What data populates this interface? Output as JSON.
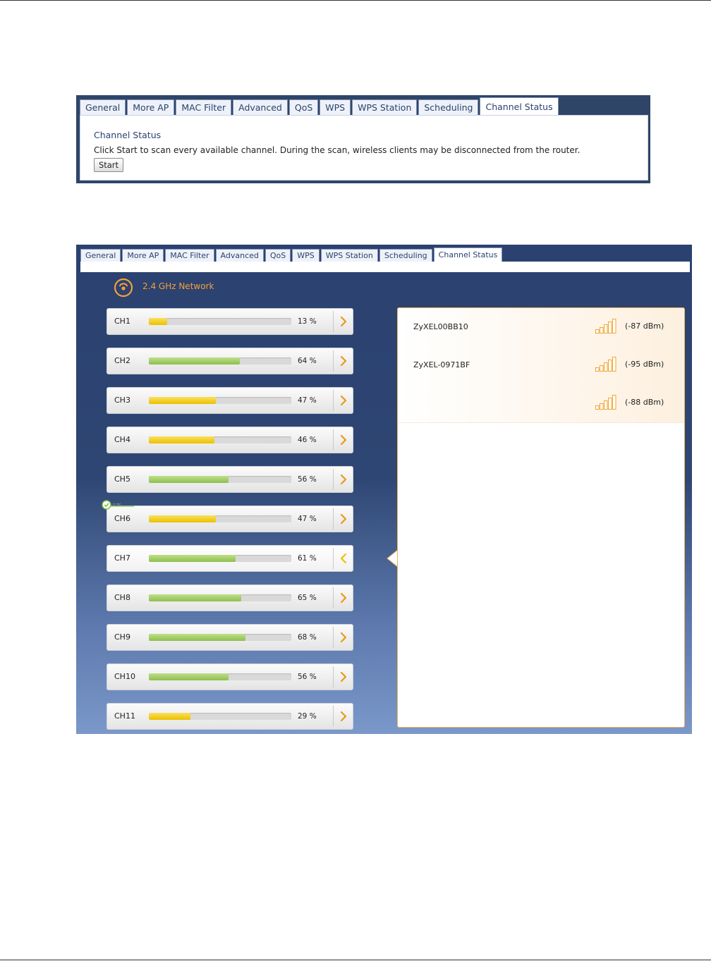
{
  "tabs": [
    "General",
    "More AP",
    "MAC Filter",
    "Advanced",
    "QoS",
    "WPS",
    "WPS Station",
    "Scheduling",
    "Channel Status"
  ],
  "active_tab": "Channel Status",
  "channel_status_panel": {
    "title": "Channel Status",
    "description": "Click Start to scan every available channel. During the scan, wireless clients may be disconnected from the router.",
    "start_button": "Start"
  },
  "scan_results": {
    "network_label": "2.4 GHz Network",
    "in_use_label": "In Use",
    "channels": [
      {
        "name": "CH1",
        "percent": 13,
        "percent_label": "13 %",
        "bar_color": "yellow"
      },
      {
        "name": "CH2",
        "percent": 64,
        "percent_label": "64 %",
        "bar_color": "green"
      },
      {
        "name": "CH3",
        "percent": 47,
        "percent_label": "47 %",
        "bar_color": "yellow"
      },
      {
        "name": "CH4",
        "percent": 46,
        "percent_label": "46 %",
        "bar_color": "yellow"
      },
      {
        "name": "CH5",
        "percent": 56,
        "percent_label": "56 %",
        "bar_color": "green"
      },
      {
        "name": "CH6",
        "percent": 47,
        "percent_label": "47 %",
        "bar_color": "yellow",
        "in_use": true
      },
      {
        "name": "CH7",
        "percent": 61,
        "percent_label": "61 %",
        "bar_color": "green",
        "selected": true
      },
      {
        "name": "CH8",
        "percent": 65,
        "percent_label": "65 %",
        "bar_color": "green"
      },
      {
        "name": "CH9",
        "percent": 68,
        "percent_label": "68 %",
        "bar_color": "green"
      },
      {
        "name": "CH10",
        "percent": 56,
        "percent_label": "56 %",
        "bar_color": "green"
      },
      {
        "name": "CH11",
        "percent": 29,
        "percent_label": "29 %",
        "bar_color": "yellow"
      }
    ],
    "access_points": [
      {
        "ssid": "ZyXEL00BB10",
        "dbm": "(-87 dBm)"
      },
      {
        "ssid": "ZyXEL-0971BF",
        "dbm": "(-95 dBm)"
      },
      {
        "ssid": "",
        "dbm": "(-88 dBm)"
      }
    ]
  },
  "colors": {
    "panel_dark": "#2f4568",
    "accent_orange": "#f4a138",
    "bar_yellow": "#edc000",
    "bar_green": "#8ebf4f",
    "tab_text": "#2a4270"
  }
}
